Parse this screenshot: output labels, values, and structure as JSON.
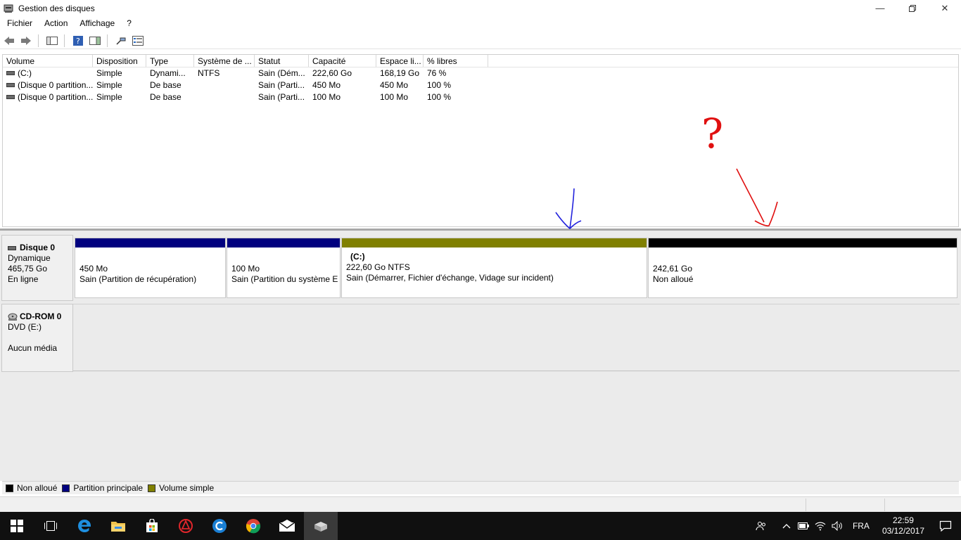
{
  "window": {
    "title": "Gestion des disques"
  },
  "menu": [
    "Fichier",
    "Action",
    "Affichage",
    "?"
  ],
  "volumes": {
    "columns": [
      "Volume",
      "Disposition",
      "Type",
      "Système de ...",
      "Statut",
      "Capacité",
      "Espace li...",
      "% libres"
    ],
    "rows": [
      [
        "(C:)",
        "Simple",
        "Dynami...",
        "NTFS",
        "Sain (Dém...",
        "222,60 Go",
        "168,19 Go",
        "76 %"
      ],
      [
        "(Disque 0 partition...",
        "Simple",
        "De base",
        "",
        "Sain (Parti...",
        "450 Mo",
        "450 Mo",
        "100 %"
      ],
      [
        "(Disque 0 partition...",
        "Simple",
        "De base",
        "",
        "Sain (Parti...",
        "100 Mo",
        "100 Mo",
        "100 %"
      ]
    ]
  },
  "disk0": {
    "name": "Disque 0",
    "kind": "Dynamique",
    "size": "465,75 Go",
    "state": "En ligne",
    "partitions": [
      {
        "title": "",
        "size": "450 Mo",
        "status": "Sain (Partition de récupération)",
        "color": "#00007f"
      },
      {
        "title": "",
        "size": "100 Mo",
        "status": "Sain (Partition du système E",
        "color": "#00007f"
      },
      {
        "title": "(C:)",
        "size": "222,60 Go NTFS",
        "status": "Sain (Démarrer, Fichier d'échange, Vidage sur incident)",
        "color": "#808000"
      },
      {
        "title": "",
        "size": "242,61 Go",
        "status": "Non alloué",
        "color": "#000000"
      }
    ]
  },
  "cdrom": {
    "name": "CD-ROM 0",
    "drive": "DVD (E:)",
    "media": "Aucun média"
  },
  "legend": [
    {
      "label": "Non alloué",
      "color": "#000000"
    },
    {
      "label": "Partition principale",
      "color": "#00007f"
    },
    {
      "label": "Volume simple",
      "color": "#808000"
    }
  ],
  "taskbar": {
    "lang": "FRA",
    "time": "22:59",
    "date": "03/12/2017"
  },
  "annotations": {
    "question_mark": "?"
  }
}
